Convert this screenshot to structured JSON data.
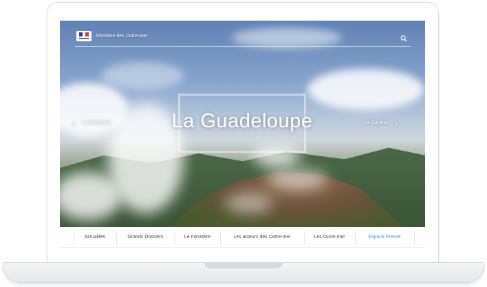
{
  "header": {
    "ministry_name": "Ministère des Outre-Mer",
    "search_icon": "search-icon"
  },
  "hero": {
    "title": "La Guadeloupe",
    "prev_label": "La Martinique",
    "next_label": "La Guyane",
    "prev_icon": "chevron-left-icon",
    "next_icon": "chevron-right-icon"
  },
  "menu": {
    "items": [
      {
        "label": "Actualités",
        "active": false
      },
      {
        "label": "Grands Dossiers",
        "active": false
      },
      {
        "label": "Le ministère",
        "active": false
      },
      {
        "label": "Les acteurs des Outre-mer",
        "active": false
      },
      {
        "label": "Les Outre-mer",
        "active": false
      },
      {
        "label": "Espace Presse",
        "active": true
      }
    ]
  },
  "colors": {
    "accent": "#4a90e2",
    "menu_text": "#4a4a4a"
  }
}
